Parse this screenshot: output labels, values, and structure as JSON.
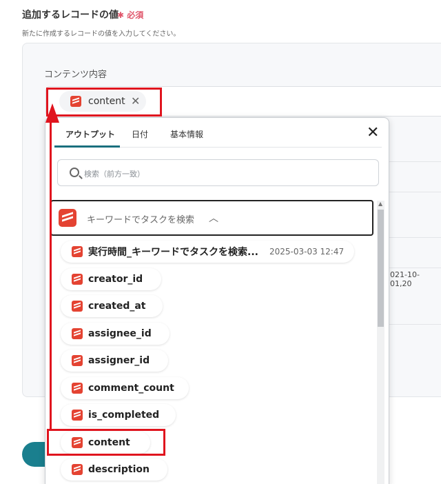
{
  "section": {
    "title": "追加するレコードの値",
    "required": "✱ 必須",
    "description": "新たに作成するレコードの値を入力してください。"
  },
  "field": {
    "label": "コンテンツ内容",
    "chip_label": "content",
    "chip_remove_icon": "close-icon"
  },
  "background": {
    "partial_value": "021-10-01,20"
  },
  "dropdown": {
    "tabs": [
      "アウトプット",
      "日付",
      "基本情報"
    ],
    "active_tab": "アウトプット",
    "close_icon": "close-icon",
    "search_placeholder": "検索（前方一致）",
    "group_label": "キーワードでタスクを検索",
    "group_icon": "chevron-up-icon",
    "items": [
      {
        "label": "実行時間_キーワードでタスクを検索...",
        "value": "2025-03-03 12:47"
      },
      {
        "label": "creator_id"
      },
      {
        "label": "created_at"
      },
      {
        "label": "assignee_id"
      },
      {
        "label": "assigner_id"
      },
      {
        "label": "comment_count"
      },
      {
        "label": "is_completed"
      },
      {
        "label": "content"
      },
      {
        "label": "description"
      }
    ]
  },
  "colors": {
    "accent": "#1a6f7e",
    "todoist": "#e44332",
    "highlight": "#e0141e",
    "required": "#e0566b"
  }
}
